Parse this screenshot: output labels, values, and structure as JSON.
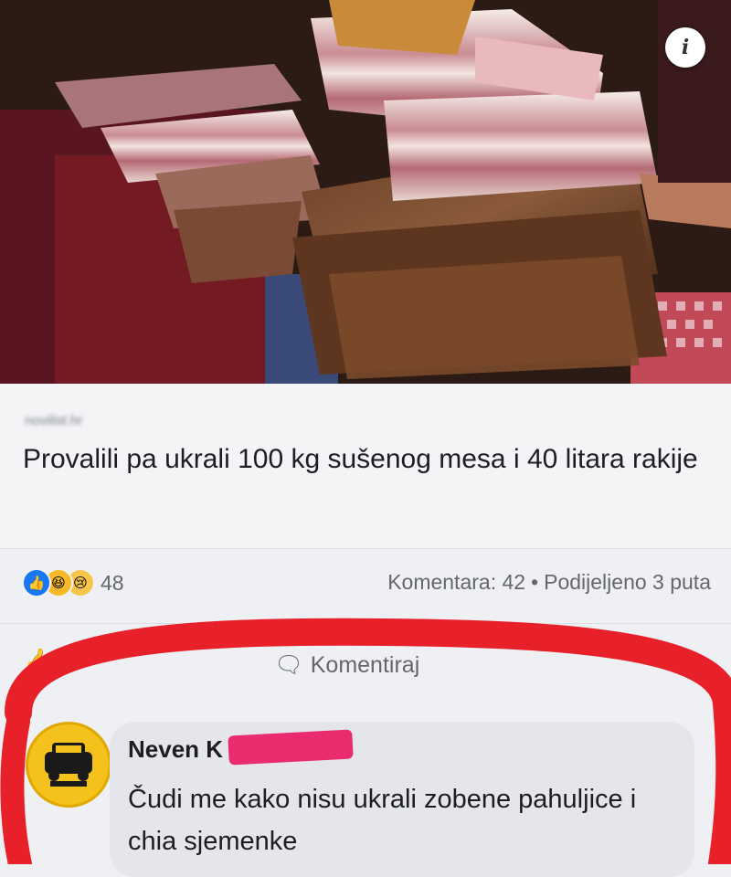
{
  "post": {
    "source": "novilist.hr",
    "headline": "Provalili pa ukrali 100 kg sušenog mesa i 40 litara rakije"
  },
  "icons": {
    "info": "info-icon",
    "like": "like-icon",
    "haha": "haha-icon",
    "sad": "sad-icon",
    "comment": "comment-icon",
    "taxi": "taxi-icon"
  },
  "stats": {
    "reaction_count": "48",
    "comments": "Komentara: 42",
    "shares": "Podijeljeno 3 puta"
  },
  "actions": {
    "comment_label": "Komentiraj"
  },
  "comment": {
    "author": "Neven K",
    "text": "Čudi me kako nisu ukrali zobene pahuljice i chia sjemenke"
  },
  "colors": {
    "accent_blue": "#1877f2",
    "highlight_circle": "#e8202a",
    "redaction": "#ea2b6d"
  }
}
